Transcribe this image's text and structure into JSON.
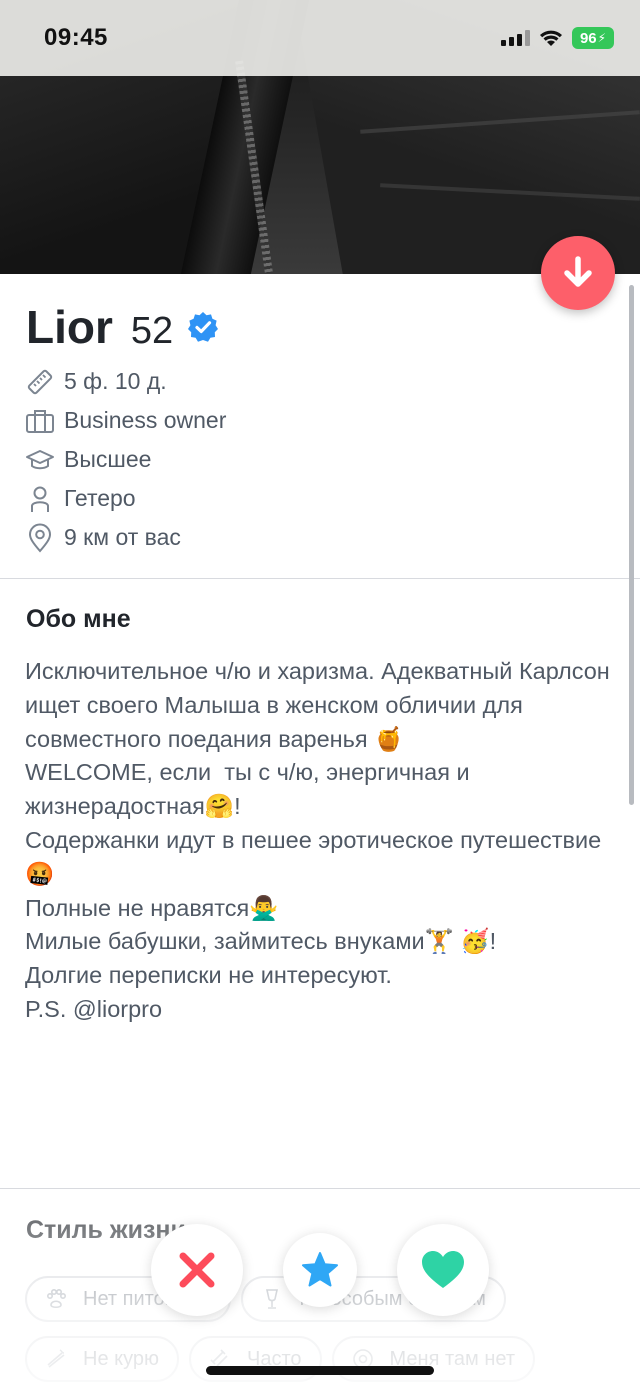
{
  "status_bar": {
    "time": "09:45",
    "battery": "96",
    "icons": [
      "signal-icon",
      "wifi-icon",
      "battery-icon"
    ]
  },
  "profile": {
    "name": "Lior",
    "age": "52",
    "verified_icon": "verified-badge-icon",
    "details": [
      {
        "icon": "ruler-icon",
        "text": "5 ф. 10 д."
      },
      {
        "icon": "briefcase-icon",
        "text": "Business owner"
      },
      {
        "icon": "graduation-cap-icon",
        "text": "Высшее"
      },
      {
        "icon": "person-icon",
        "text": "Гетеро"
      },
      {
        "icon": "location-pin-icon",
        "text": "9 км от вас"
      }
    ]
  },
  "about": {
    "title": "Обо мне",
    "text": "Исключительное ч/ю и харизма. Адекватный Карлсон ищет своего Малыша в женском обличии для совместного поедания варенья 🍯\nWELCOME, если  ты с ч/ю, энергичная и жизнерадостная🤗!\nСодержанки идут в пешее эротическое путешествие🤬\nПолные не нравятся🙅‍♂️\nМилые бабушки, займитесь внуками🏋 🥳!\nДолгие переписки не интересуют.\nP.S. @liorpro"
  },
  "lifestyle": {
    "title": "Стиль жизни",
    "chips": [
      {
        "icon": "paw-icon",
        "label": "Нет питомцев"
      },
      {
        "icon": "glass-icon",
        "label": "По особым случаям"
      },
      {
        "icon": "no-smoking-icon",
        "label": "Не курю"
      },
      {
        "icon": "dumbbell-icon",
        "label": "Часто"
      },
      {
        "icon": "at-icon",
        "label": "Меня там нет"
      }
    ]
  },
  "actions": {
    "nope": "close-x-icon",
    "super_like": "star-icon",
    "like": "heart-icon",
    "dislike_profile": "arrow-down-icon"
  },
  "colors": {
    "nope": "#fd4c5b",
    "star": "#2fa7f5",
    "like": "#2ed3a5",
    "dislike_fab": "#fd5f6a",
    "verified": "#2e93f5",
    "text_primary": "#21252b",
    "text_secondary": "#505965"
  }
}
